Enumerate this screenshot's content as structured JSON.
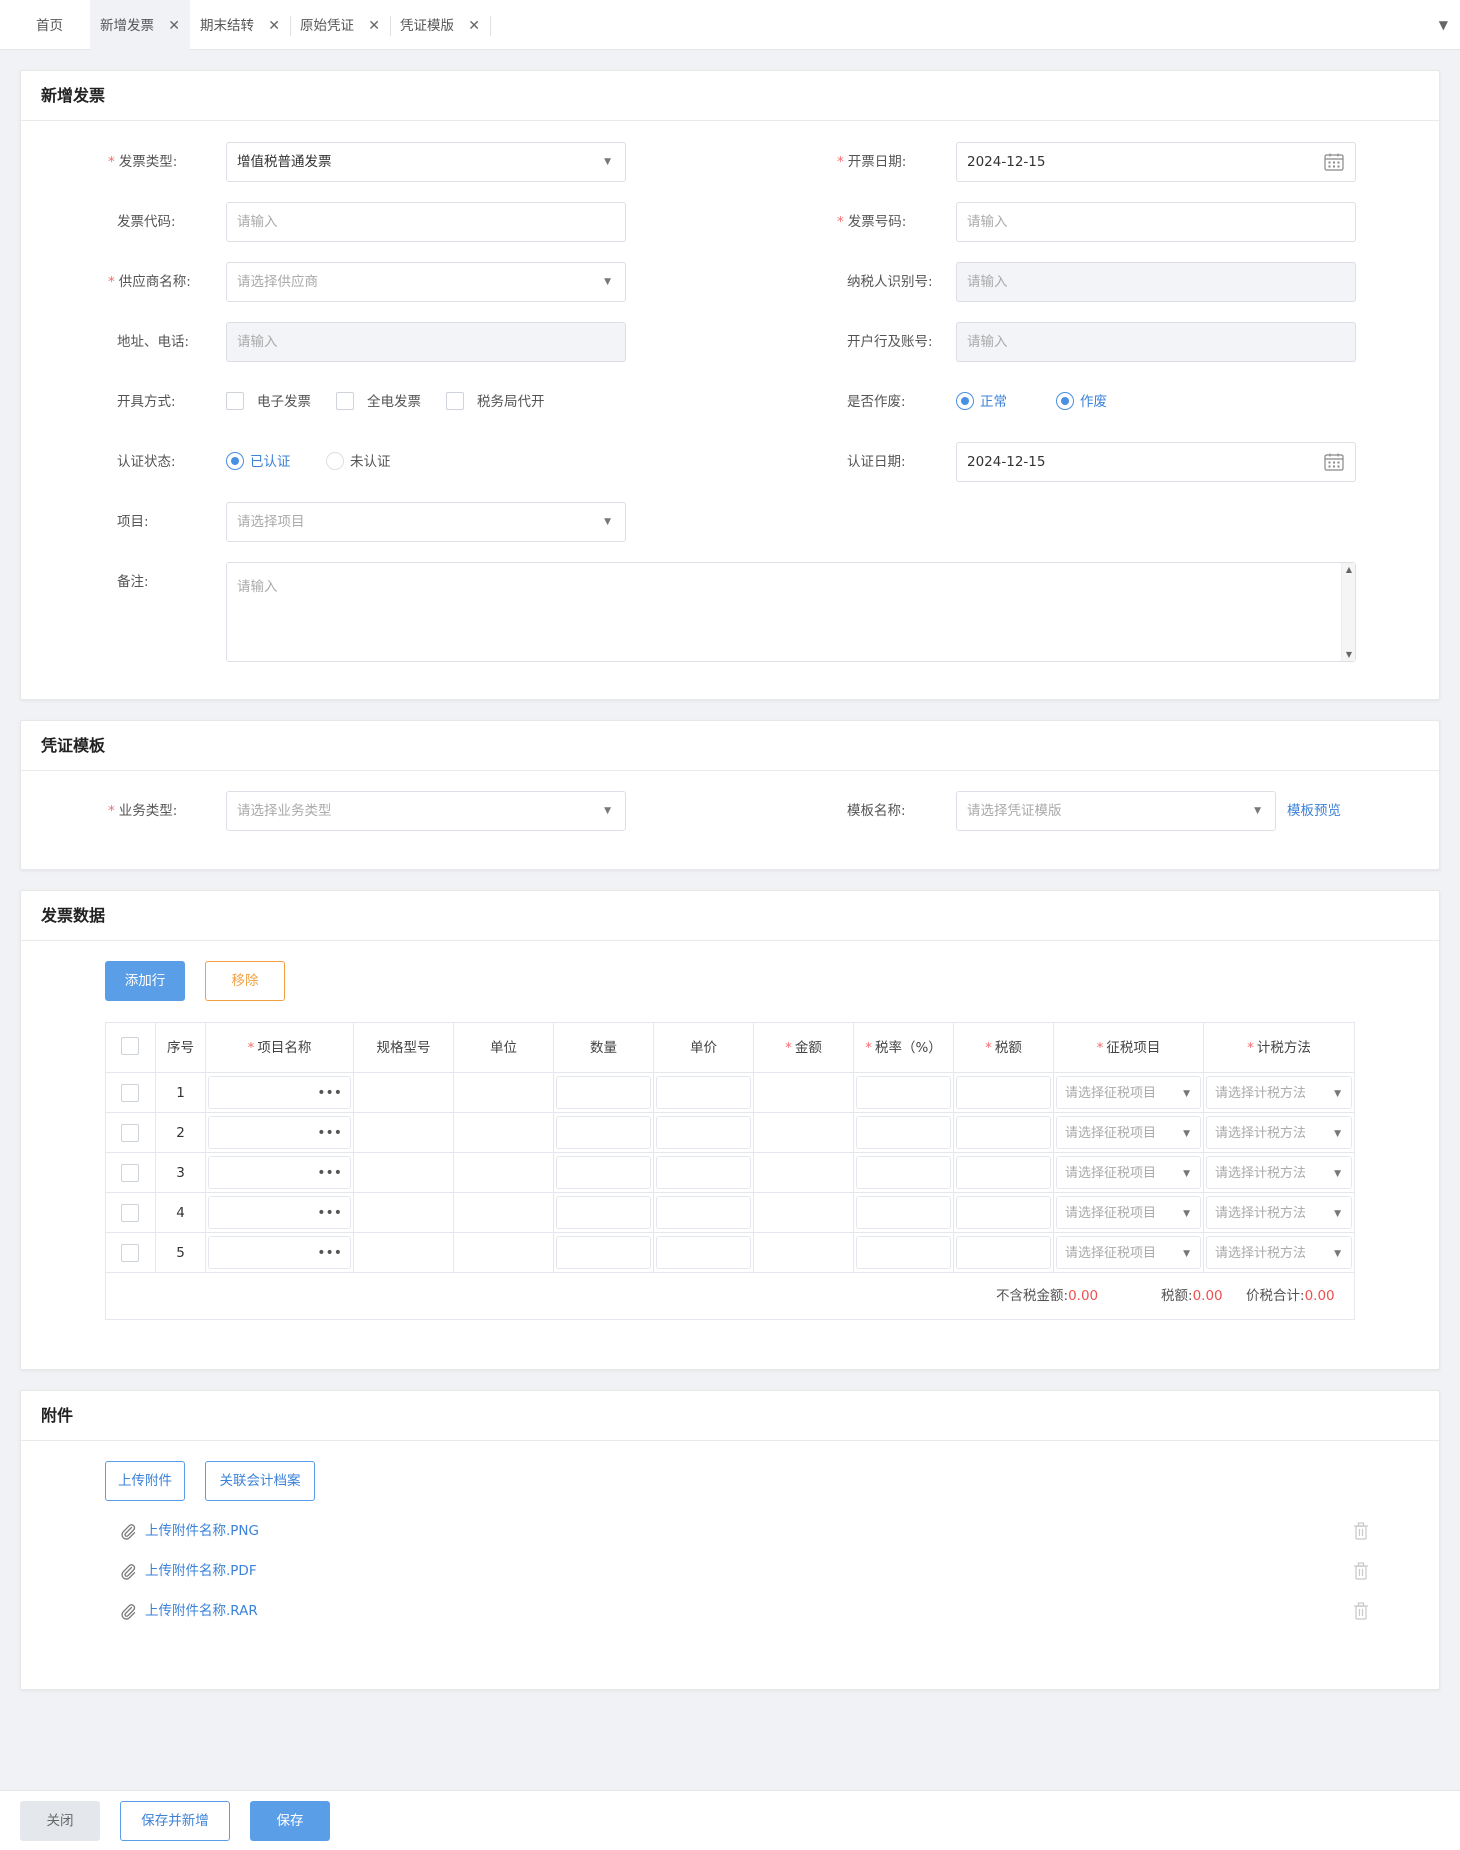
{
  "tabs": [
    {
      "label": "首页",
      "closable": false,
      "active": false
    },
    {
      "label": "新增发票",
      "closable": true,
      "active": true
    },
    {
      "label": "期末结转",
      "closable": true,
      "active": false
    },
    {
      "label": "原始凭证",
      "closable": true,
      "active": false
    },
    {
      "label": "凭证模版",
      "closable": true,
      "active": false
    }
  ],
  "tab_close_glyph": "✕",
  "tab_menu_glyph": "▼",
  "dropdown_glyph": "▼",
  "invoice": {
    "title": "新增发票",
    "required_mark": "*",
    "invoice_type": {
      "label": "发票类型:",
      "value": "增值税普通发票"
    },
    "issue_date": {
      "label": "开票日期:",
      "value": "2024-12-15"
    },
    "invoice_code": {
      "label": "发票代码:",
      "placeholder": "请输入"
    },
    "invoice_number": {
      "label": "发票号码:",
      "placeholder": "请输入"
    },
    "supplier": {
      "label": "供应商名称:",
      "placeholder": "请选择供应商"
    },
    "taxpayer_id": {
      "label": "纳税人识别号:",
      "placeholder": "请输入"
    },
    "address_phone": {
      "label": "地址、电话:",
      "placeholder": "请输入"
    },
    "bank_account": {
      "label": "开户行及账号:",
      "placeholder": "请输入"
    },
    "issue_method": {
      "label": "开具方式:",
      "options": [
        "电子发票",
        "全电发票",
        "税务局代开"
      ]
    },
    "voided": {
      "label": "是否作废:",
      "options": [
        "正常",
        "作废"
      ]
    },
    "cert_status": {
      "label": "认证状态:",
      "options": [
        "已认证",
        "未认证"
      ],
      "selected": "已认证"
    },
    "cert_date": {
      "label": "认证日期:",
      "value": "2024-12-15"
    },
    "project": {
      "label": "项目:",
      "placeholder": "请选择项目"
    },
    "remark": {
      "label": "备注:",
      "placeholder": "请输入"
    }
  },
  "voucher": {
    "title": "凭证模板",
    "business_type": {
      "label": "业务类型:",
      "placeholder": "请选择业务类型"
    },
    "template_name": {
      "label": "模板名称:",
      "placeholder": "请选择凭证模版"
    },
    "preview_link": "模板预览"
  },
  "invoice_data": {
    "title": "发票数据",
    "add_row": "添加行",
    "remove": "移除",
    "columns": [
      "序号",
      "项目名称",
      "规格型号",
      "单位",
      "数量",
      "单价",
      "金额",
      "税率（%）",
      "税额",
      "征税项目",
      "计税方法"
    ],
    "rows": [
      "1",
      "2",
      "3",
      "4",
      "5"
    ],
    "ellipsis": "•••",
    "tax_item_placeholder": "请选择征税项目",
    "tax_method_placeholder": "请选择计税方法",
    "summary": {
      "pre_tax_label": "不含税金额:",
      "pre_tax_value": "0.00",
      "tax_label": "税额:",
      "tax_value": "0.00",
      "total_label": "价税合计:",
      "total_value": "0.00"
    }
  },
  "attachments": {
    "title": "附件",
    "upload": "上传附件",
    "link_archive": "关联会计档案",
    "files": [
      "上传附件名称.PNG",
      "上传附件名称.PDF",
      "上传附件名称.RAR"
    ]
  },
  "footer": {
    "close": "关闭",
    "save_and_new": "保存并新增",
    "save": "保存"
  },
  "colors": {
    "primary": "#5b9ee8",
    "link": "#3b82d8",
    "danger": "#f05050",
    "warning": "#f0a040",
    "required": "#f56c6c"
  }
}
